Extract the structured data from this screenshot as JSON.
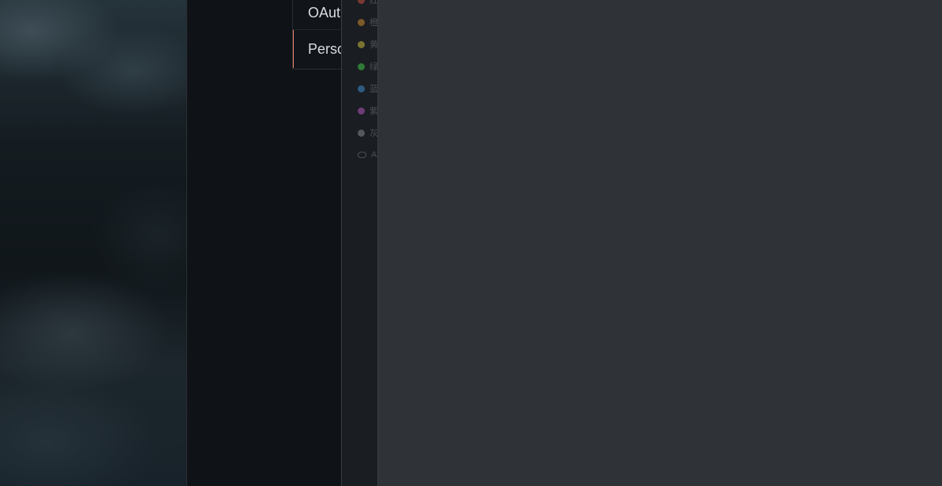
{
  "settings_nav": {
    "items": [
      {
        "label": "OAuth",
        "active": false
      },
      {
        "label": "Perso",
        "active": true
      }
    ]
  },
  "labels": [
    {
      "text": "红",
      "color": "#7a3a32"
    },
    {
      "text": "橙",
      "color": "#7d5a2a"
    },
    {
      "text": "黄",
      "color": "#7a7430"
    },
    {
      "text": "绿",
      "color": "#2e7a36"
    },
    {
      "text": "蓝",
      "color": "#2e5a80"
    },
    {
      "text": "紫",
      "color": "#6e3c78"
    },
    {
      "text": "灰",
      "color": "#55595e"
    }
  ],
  "labels_more": {
    "text": "A",
    "icon": "tag-outline-icon"
  },
  "colors": {
    "accent": "#f0826a",
    "content_bg": "#2f3338",
    "panel_bg": "#1a1d21",
    "window_bg": "#0f1216"
  }
}
